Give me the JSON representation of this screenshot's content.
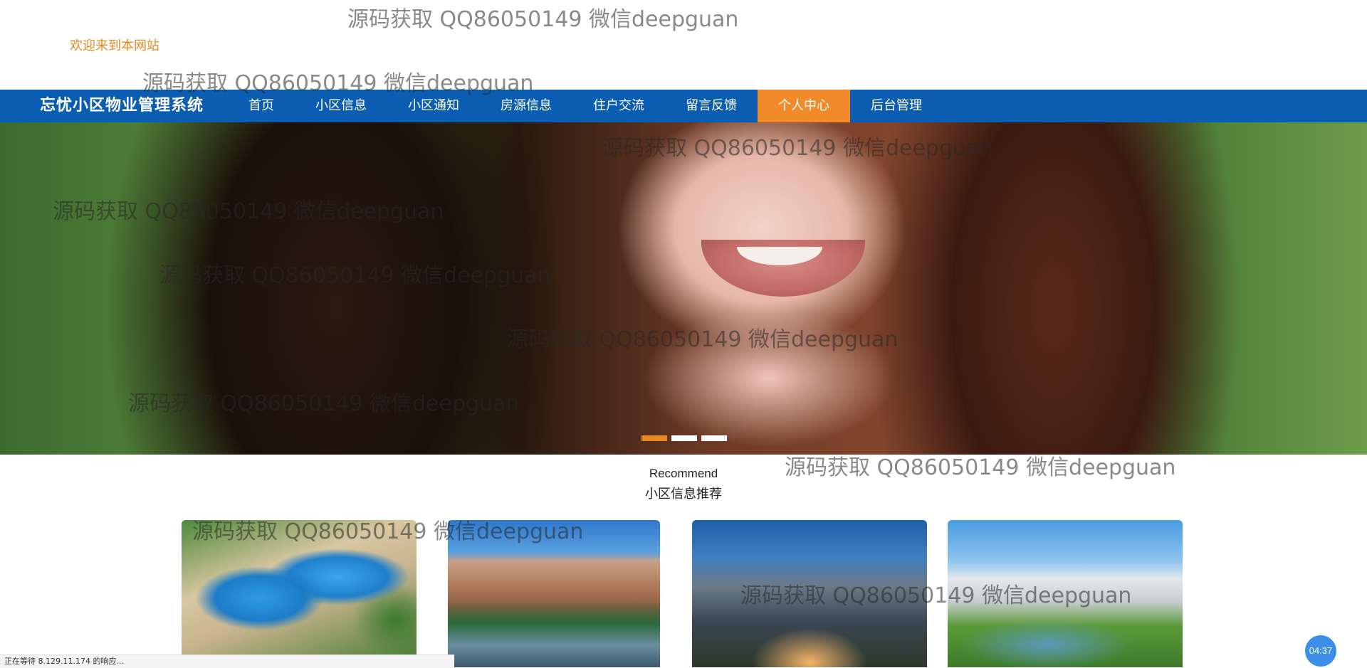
{
  "header": {
    "welcome": "欢迎来到本网站"
  },
  "nav": {
    "brand": "忘忧小区物业管理系统",
    "items": [
      {
        "label": "首页"
      },
      {
        "label": "小区信息"
      },
      {
        "label": "小区通知"
      },
      {
        "label": "房源信息"
      },
      {
        "label": "住户交流"
      },
      {
        "label": "留言反馈"
      },
      {
        "label": "个人中心"
      },
      {
        "label": "后台管理"
      }
    ],
    "active_item": "个人中心",
    "colors": {
      "bar": "#0a5db0",
      "active": "#f08a2a"
    }
  },
  "banner": {
    "slide_count": 3,
    "active_slide": 1
  },
  "recommend": {
    "title_en": "Recommend",
    "title_cn": "小区信息推荐",
    "cards": [
      {
        "image": "pool-garden"
      },
      {
        "image": "villa-lake"
      },
      {
        "image": "towers-dusk"
      },
      {
        "image": "apartments-park"
      }
    ]
  },
  "watermarks": [
    "源码获取 QQ86050149 微信deepguan",
    "源码获取 QQ86050149 微信deepguan",
    "源码获取 QQ86050149 微信deepguan",
    "源码获取 QQ86050149 微信deepguan",
    "源码获取 QQ86050149 微信deepguan",
    "源码获取 QQ86050149 微信deepguan",
    "源码获取 QQ86050149 微信deepguan",
    "源码获取 QQ86050149 微信deepguan",
    "源码获取 QQ86050149 微信deepguan",
    "源码获取 QQ86050149 微信deepguan"
  ],
  "status_bar": {
    "text": "正在等待 8.129.11.174 的响应..."
  },
  "timer": {
    "text": "04:37"
  }
}
